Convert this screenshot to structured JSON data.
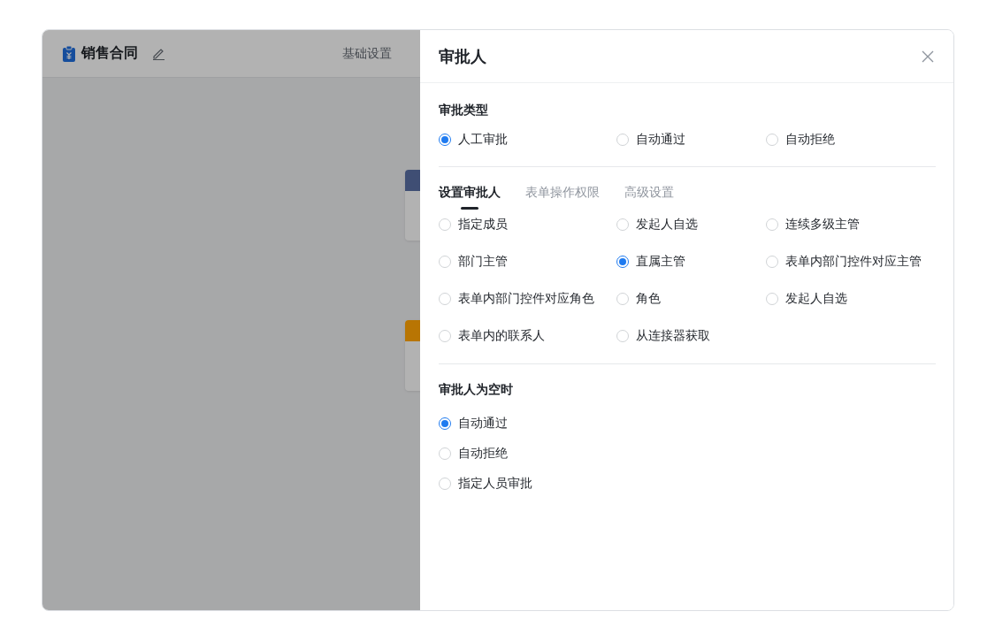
{
  "editor": {
    "title": "销售合同",
    "nav_label": "基础设置",
    "nodes": [
      {
        "color": "#3f4e74"
      },
      {
        "color": "#b87503"
      }
    ]
  },
  "panel": {
    "title": "审批人",
    "approval_type": {
      "label": "审批类型",
      "options": [
        {
          "label": "人工审批",
          "selected": true
        },
        {
          "label": "自动通过",
          "selected": false
        },
        {
          "label": "自动拒绝",
          "selected": false
        }
      ]
    },
    "tabs": [
      {
        "label": "设置审批人",
        "selected": true
      },
      {
        "label": "表单操作权限",
        "selected": false
      },
      {
        "label": "高级设置",
        "selected": false
      }
    ],
    "approver_options": [
      {
        "label": "指定成员",
        "selected": false
      },
      {
        "label": "发起人自选",
        "selected": false
      },
      {
        "label": "连续多级主管",
        "selected": false
      },
      {
        "label": "部门主管",
        "selected": false
      },
      {
        "label": "直属主管",
        "selected": true
      },
      {
        "label": "表单内部门控件对应主管",
        "selected": false
      },
      {
        "label": "表单内部门控件对应角色",
        "selected": false
      },
      {
        "label": "角色",
        "selected": false
      },
      {
        "label": "发起人自选",
        "selected": false
      },
      {
        "label": "表单内的联系人",
        "selected": false
      },
      {
        "label": "从连接器获取",
        "selected": false
      }
    ],
    "empty_approver": {
      "label": "审批人为空时",
      "options": [
        {
          "label": "自动通过",
          "selected": true
        },
        {
          "label": "自动拒绝",
          "selected": false
        },
        {
          "label": "指定人员审批",
          "selected": false
        }
      ]
    }
  }
}
